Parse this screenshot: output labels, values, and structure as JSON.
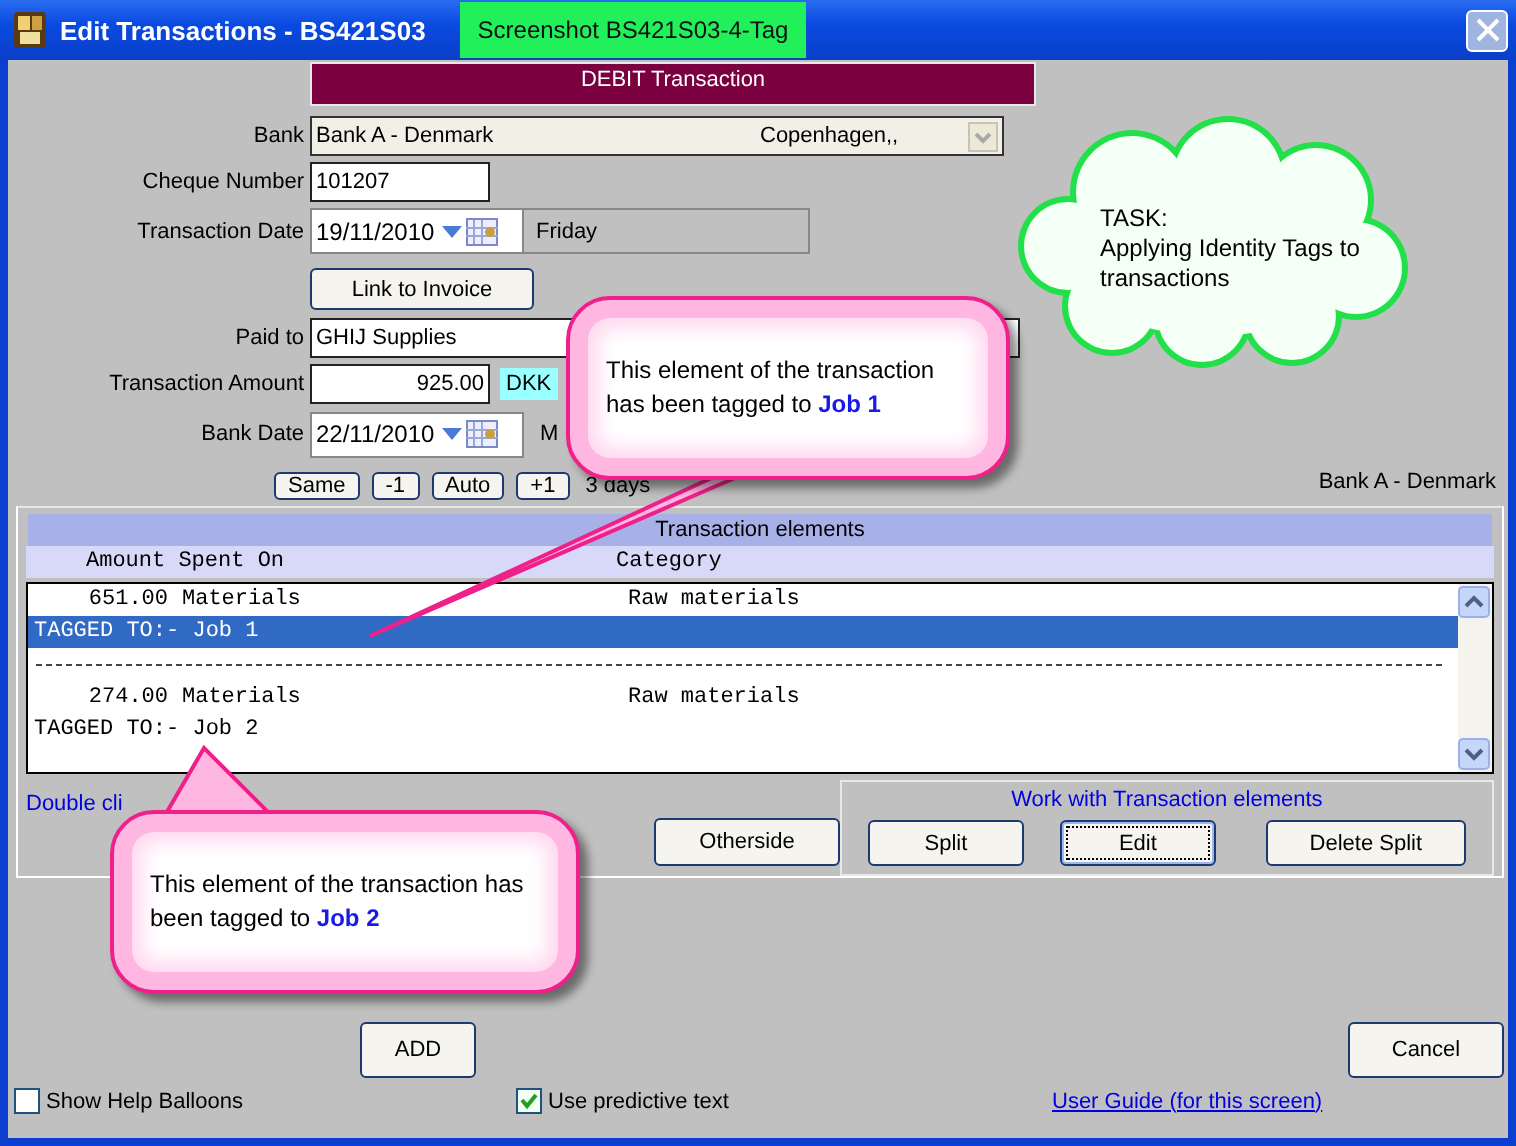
{
  "window": {
    "title": "Edit Transactions - BS421S03",
    "tag": "Screenshot BS421S03-4-Tag"
  },
  "banner": "DEBIT Transaction",
  "bank": {
    "label": "Bank",
    "value": "Bank A - Denmark",
    "location": "Copenhagen,,"
  },
  "cheque": {
    "label": "Cheque Number",
    "value": "101207"
  },
  "transaction_date": {
    "label": "Transaction Date",
    "value": "19/11/2010",
    "day": "Friday"
  },
  "link_button": "Link to Invoice",
  "paid_to": {
    "label": "Paid to",
    "value": "GHIJ Supplies"
  },
  "amount": {
    "label": "Transaction Amount",
    "value": "925.00",
    "currency": "DKK"
  },
  "bank_date": {
    "label": "Bank Date",
    "value": "22/11/2010",
    "day": "M"
  },
  "bank_name": "Bank A - Denmark",
  "date_buttons": [
    "Same",
    "-1",
    "Auto",
    "+1"
  ],
  "days": "3 days",
  "elements": {
    "title": "Transaction elements",
    "columns": [
      "Amount Spent On",
      "Category"
    ],
    "rows": [
      {
        "kind": "item",
        "amount": "651.00",
        "description": "Materials",
        "category": "Raw materials",
        "selected": false
      },
      {
        "kind": "tag",
        "text": "TAGGED TO:- Job 1",
        "selected": true
      },
      {
        "kind": "separator",
        "selected": false
      },
      {
        "kind": "item",
        "amount": "274.00",
        "description": "Materials",
        "category": "Raw materials",
        "selected": false
      },
      {
        "kind": "tag",
        "text": "TAGGED TO:- Job 2",
        "selected": false
      }
    ]
  },
  "hint": "Double cli",
  "otherside_button": "Otherside",
  "work_group": {
    "title": "Work with Transaction elements",
    "buttons": [
      {
        "label": "Split",
        "focused": false
      },
      {
        "label": "Edit",
        "focused": true
      },
      {
        "label": "Delete Split",
        "focused": false
      }
    ]
  },
  "add_button": "ADD",
  "cancel_button": "Cancel",
  "options": [
    {
      "label": "Show Help Balloons",
      "checked": false
    },
    {
      "label": "Use predictive text",
      "checked": true
    }
  ],
  "user_guide_link": "User Guide (for this screen)",
  "callouts": [
    {
      "kind": "cloud",
      "title": "TASK:",
      "text": "Applying Identity Tags to transactions"
    },
    {
      "kind": "balloon",
      "text": "This element of the transaction has been tagged to **Job 1**"
    },
    {
      "kind": "balloon",
      "text": "This element of the transaction has been tagged to **Job 2**"
    }
  ]
}
